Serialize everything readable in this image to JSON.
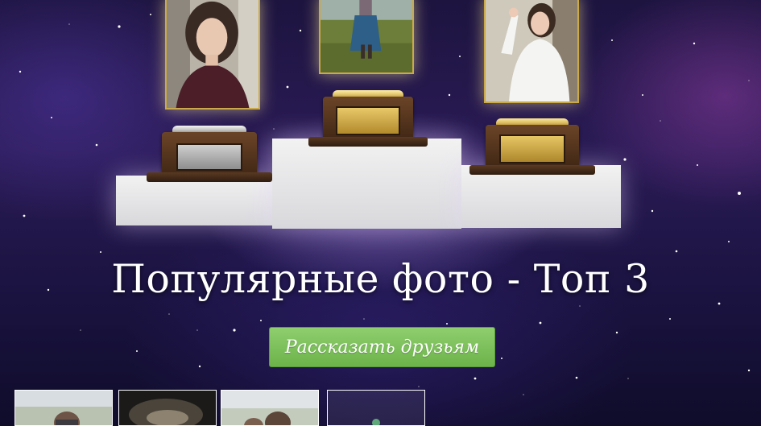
{
  "headline": "Популярные фото - Топ 3",
  "share_button_label": "Рассказать друзьям",
  "colors": {
    "accent_green": "#6cb34a",
    "gold": "#c9a94a",
    "silver": "#a8a8a8",
    "podium": "#e6e6e8"
  },
  "podium": {
    "places": [
      {
        "rank": 2,
        "plate_color": "silver"
      },
      {
        "rank": 1,
        "plate_color": "gold"
      },
      {
        "rank": 3,
        "plate_color": "gold"
      }
    ]
  },
  "thumbnails_count": 4
}
